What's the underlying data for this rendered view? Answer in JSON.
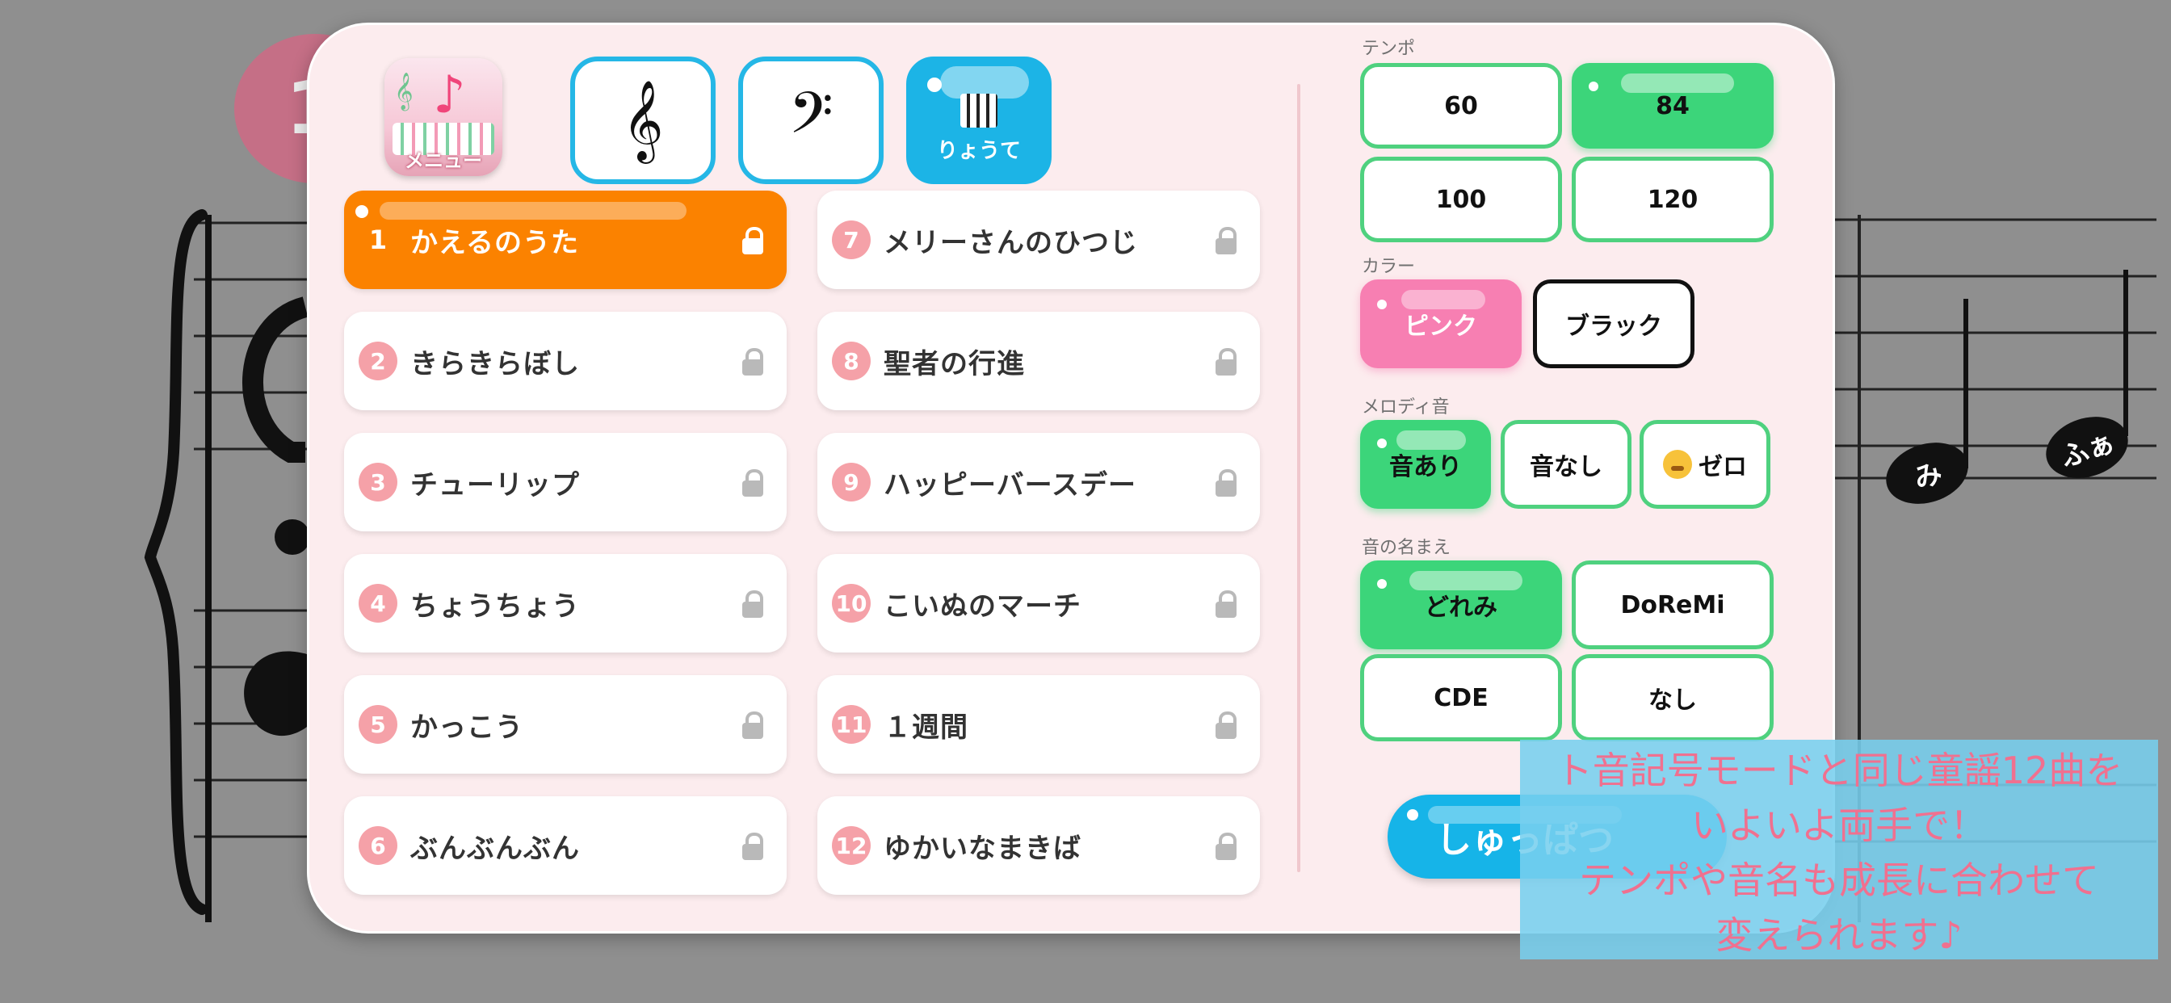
{
  "background": {
    "badge_digit": "1",
    "notes": [
      {
        "label": "み"
      },
      {
        "label": "ふぁ"
      }
    ]
  },
  "menu": {
    "label": "メニュー"
  },
  "modes": {
    "treble_glyph": "𝄞",
    "bass_glyph": "𝄢",
    "both_label": "りょうて",
    "selected": "both"
  },
  "songs": [
    {
      "num": "1",
      "title": "かえるのうた",
      "locked": true,
      "selected": true
    },
    {
      "num": "2",
      "title": "きらきらぼし",
      "locked": true
    },
    {
      "num": "3",
      "title": "チューリップ",
      "locked": true
    },
    {
      "num": "4",
      "title": "ちょうちょう",
      "locked": true
    },
    {
      "num": "5",
      "title": "かっこう",
      "locked": true
    },
    {
      "num": "6",
      "title": "ぶんぶんぶん",
      "locked": true
    },
    {
      "num": "7",
      "title": "メリーさんのひつじ",
      "locked": true
    },
    {
      "num": "8",
      "title": "聖者の行進",
      "locked": true
    },
    {
      "num": "9",
      "title": "ハッピーバースデー",
      "locked": true
    },
    {
      "num": "10",
      "title": "こいぬのマーチ",
      "locked": true
    },
    {
      "num": "11",
      "title": "１週間",
      "locked": true
    },
    {
      "num": "12",
      "title": "ゆかいなまきば",
      "locked": true
    }
  ],
  "settings": {
    "tempo": {
      "label": "テンポ",
      "options": [
        "60",
        "84",
        "100",
        "120"
      ],
      "selected": "84"
    },
    "color": {
      "label": "カラー",
      "options": [
        "ピンク",
        "ブラック"
      ],
      "selected": "ピンク"
    },
    "melody": {
      "label": "メロディ音",
      "options": [
        "音あり",
        "音なし",
        "ゼロ"
      ],
      "selected": "音あり"
    },
    "note_names": {
      "label": "音の名まえ",
      "options": [
        "どれみ",
        "DoReMi",
        "CDE",
        "なし"
      ],
      "selected": "どれみ"
    }
  },
  "start": {
    "label": "しゅっぱつ"
  },
  "caption": {
    "lines": [
      "ト音記号モードと同じ童謡12曲を",
      "いよいよ両手で！",
      "テンポや音名も成長に合わせて",
      "変えられます♪"
    ]
  },
  "colors": {
    "accent_orange": "#fb8200",
    "accent_green": "#3cd57a",
    "accent_blue": "#16b4e8",
    "accent_pink": "#f77fb2",
    "number_badge": "#f5a1a8"
  }
}
